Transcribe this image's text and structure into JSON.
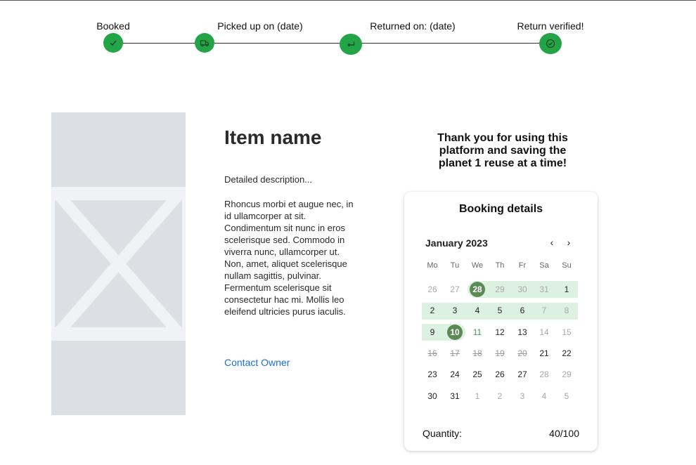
{
  "steps": [
    {
      "label": "Booked",
      "icon": "check-icon"
    },
    {
      "label": "Picked up on (date)",
      "icon": "truck-icon"
    },
    {
      "label": "Returned on: (date)",
      "icon": "return-arrow-icon"
    },
    {
      "label": "Return verified!",
      "icon": "check-circle-icon"
    }
  ],
  "step_color": "#22a447",
  "item": {
    "name": "Item name",
    "description_short": "Detailed description...",
    "description_long": "Rhoncus morbi et augue nec, in id ullamcorper at sit. Condimentum sit nunc in eros scelerisque sed. Commodo in viverra nunc, ullamcorper ut. Non, amet, aliquet scelerisque nullam sagittis, pulvinar. Fermentum scelerisque sit consectetur hac mi. Mollis leo eleifend ultricies purus iaculis.",
    "contact_label": "Contact Owner"
  },
  "thank_you": "Thank you for using this platform and saving the planet 1 reuse at a time!",
  "booking": {
    "title": "Booking details",
    "month": "January 2023",
    "prev_icon": "chevron-left-icon",
    "next_icon": "chevron-right-icon",
    "weekdays": [
      "Mo",
      "Tu",
      "We",
      "Th",
      "Fr",
      "Sa",
      "Su"
    ],
    "weeks": [
      [
        {
          "d": "26",
          "s": "muted"
        },
        {
          "d": "27",
          "s": "muted"
        },
        {
          "d": "28",
          "s": "selected"
        },
        {
          "d": "29",
          "s": "muted"
        },
        {
          "d": "30",
          "s": "muted"
        },
        {
          "d": "31",
          "s": "muted"
        },
        {
          "d": "1",
          "s": "normal"
        }
      ],
      [
        {
          "d": "2",
          "s": "normal"
        },
        {
          "d": "3",
          "s": "normal"
        },
        {
          "d": "4",
          "s": "normal"
        },
        {
          "d": "5",
          "s": "normal"
        },
        {
          "d": "6",
          "s": "normal"
        },
        {
          "d": "7",
          "s": "muted"
        },
        {
          "d": "8",
          "s": "muted"
        }
      ],
      [
        {
          "d": "9",
          "s": "normal"
        },
        {
          "d": "10",
          "s": "selected"
        },
        {
          "d": "11",
          "s": "green"
        },
        {
          "d": "12",
          "s": "normal"
        },
        {
          "d": "13",
          "s": "normal"
        },
        {
          "d": "14",
          "s": "muted"
        },
        {
          "d": "15",
          "s": "muted"
        }
      ],
      [
        {
          "d": "16",
          "s": "struck"
        },
        {
          "d": "17",
          "s": "struck"
        },
        {
          "d": "18",
          "s": "struck"
        },
        {
          "d": "19",
          "s": "struck"
        },
        {
          "d": "20",
          "s": "struck"
        },
        {
          "d": "21",
          "s": "normal"
        },
        {
          "d": "22",
          "s": "normal"
        }
      ],
      [
        {
          "d": "23",
          "s": "normal"
        },
        {
          "d": "24",
          "s": "normal"
        },
        {
          "d": "25",
          "s": "normal"
        },
        {
          "d": "26",
          "s": "normal"
        },
        {
          "d": "27",
          "s": "normal"
        },
        {
          "d": "28",
          "s": "muted"
        },
        {
          "d": "29",
          "s": "muted"
        }
      ],
      [
        {
          "d": "30",
          "s": "normal"
        },
        {
          "d": "31",
          "s": "normal"
        },
        {
          "d": "1",
          "s": "muted"
        },
        {
          "d": "2",
          "s": "muted"
        },
        {
          "d": "3",
          "s": "muted"
        },
        {
          "d": "4",
          "s": "muted"
        },
        {
          "d": "5",
          "s": "muted"
        }
      ]
    ],
    "range_color": "#ddf1e0",
    "selected_color": "#5b8a55",
    "quantity_label": "Quantity:",
    "quantity_value": "40/100"
  }
}
